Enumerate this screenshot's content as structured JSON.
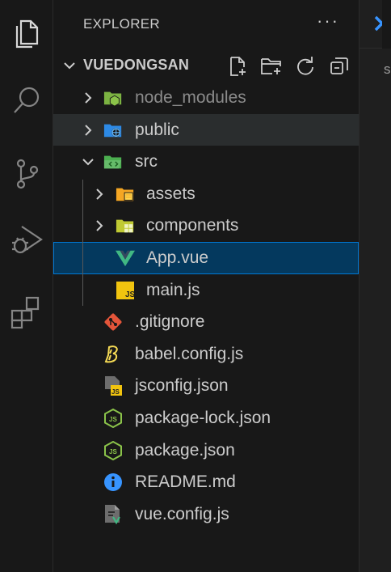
{
  "sidebar": {
    "title": "EXPLORER",
    "more_label": "···",
    "folder_name": "VUEDONGSAN"
  },
  "tree": [
    {
      "label": "node_modules",
      "kind": "folder",
      "expanded": false,
      "icon": "node-folder-icon",
      "dim": true
    },
    {
      "label": "public",
      "kind": "folder",
      "expanded": false,
      "icon": "public-folder-icon"
    },
    {
      "label": "src",
      "kind": "folder",
      "expanded": true,
      "icon": "src-folder-icon"
    },
    {
      "label": "assets",
      "kind": "folder",
      "expanded": false,
      "icon": "assets-folder-icon"
    },
    {
      "label": "components",
      "kind": "folder",
      "expanded": false,
      "icon": "components-folder-icon"
    },
    {
      "label": "App.vue",
      "kind": "file",
      "icon": "vue-icon",
      "selected": true
    },
    {
      "label": "main.js",
      "kind": "file",
      "icon": "js-icon"
    },
    {
      "label": ".gitignore",
      "kind": "file",
      "icon": "git-icon"
    },
    {
      "label": "babel.config.js",
      "kind": "file",
      "icon": "babel-icon"
    },
    {
      "label": "jsconfig.json",
      "kind": "file",
      "icon": "jsconfig-icon"
    },
    {
      "label": "package-lock.json",
      "kind": "file",
      "icon": "nodejs-icon"
    },
    {
      "label": "package.json",
      "kind": "file",
      "icon": "nodejs-icon"
    },
    {
      "label": "README.md",
      "kind": "file",
      "icon": "info-icon"
    },
    {
      "label": "vue.config.js",
      "kind": "file",
      "icon": "vue-config-icon"
    }
  ],
  "editor": {
    "breadcrumb": "s"
  },
  "colors": {
    "background": "#181818",
    "selected_bg": "#04395e",
    "selected_border": "#0078d4",
    "hover_bg": "#2a2d2e",
    "vue_green": "#41b883",
    "js_yellow": "#f1c40f",
    "folder_yellow": "#f5c542",
    "folder_green": "#7cb342",
    "folder_blue": "#2d8ae6",
    "git_orange": "#e4553a",
    "info_blue": "#3794ff",
    "tab_accent": "#3794ff"
  }
}
